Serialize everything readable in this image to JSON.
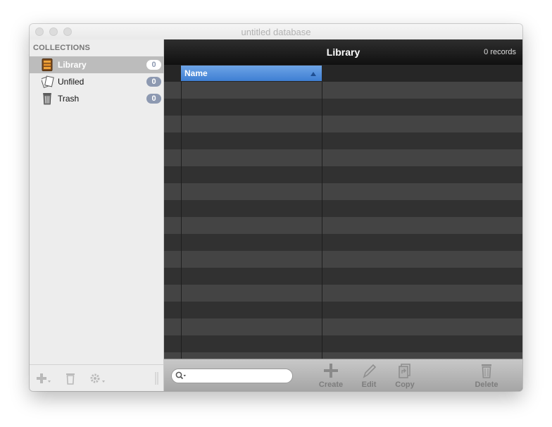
{
  "window": {
    "title": "untitled database"
  },
  "sidebar": {
    "header": "COLLECTIONS",
    "items": [
      {
        "label": "Library",
        "count": "0",
        "selected": true,
        "icon": "library-icon"
      },
      {
        "label": "Unfiled",
        "count": "0",
        "selected": false,
        "icon": "unfiled-icon"
      },
      {
        "label": "Trash",
        "count": "0",
        "selected": false,
        "icon": "trash-can-icon"
      }
    ],
    "bottom_buttons": [
      "add-collection-icon",
      "delete-collection-icon",
      "gear-icon",
      "resize-handle-icon"
    ]
  },
  "main": {
    "title": "Library",
    "record_count": "0 records",
    "table": {
      "columns": [
        "Name"
      ],
      "sort": "ascending",
      "rows": []
    },
    "search": {
      "placeholder": "",
      "value": ""
    },
    "toolbar": {
      "create": "Create",
      "edit": "Edit",
      "copy": "Copy",
      "delete": "Delete"
    }
  },
  "colors": {
    "selection_blue": "#3f7fd3",
    "badge": "#8d99b1",
    "toolbar_disabled_text": "#7d7d7d"
  }
}
